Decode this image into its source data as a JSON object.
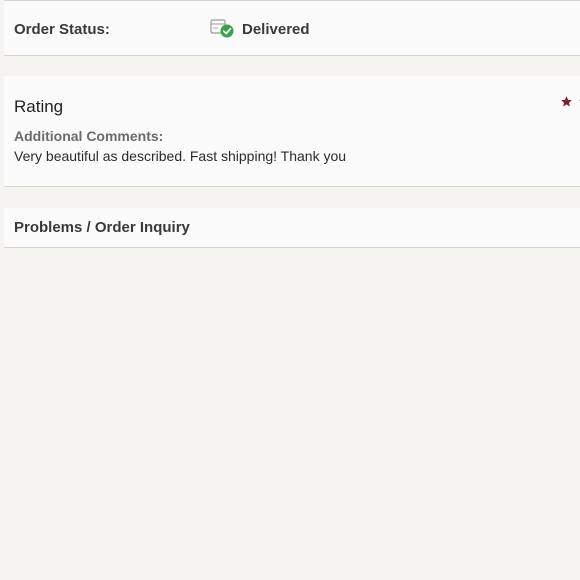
{
  "order_status": {
    "label": "Order Status:",
    "value": "Delivered",
    "icon": "delivered-package-check-icon",
    "check_color": "#3aa34a"
  },
  "rating": {
    "title": "Rating",
    "star_color": "#7a2330",
    "comments_label": "Additional Comments:",
    "comments_text": "Very beautiful as described. Fast shipping! Thank you"
  },
  "inquiry": {
    "label": "Problems / Order Inquiry"
  }
}
